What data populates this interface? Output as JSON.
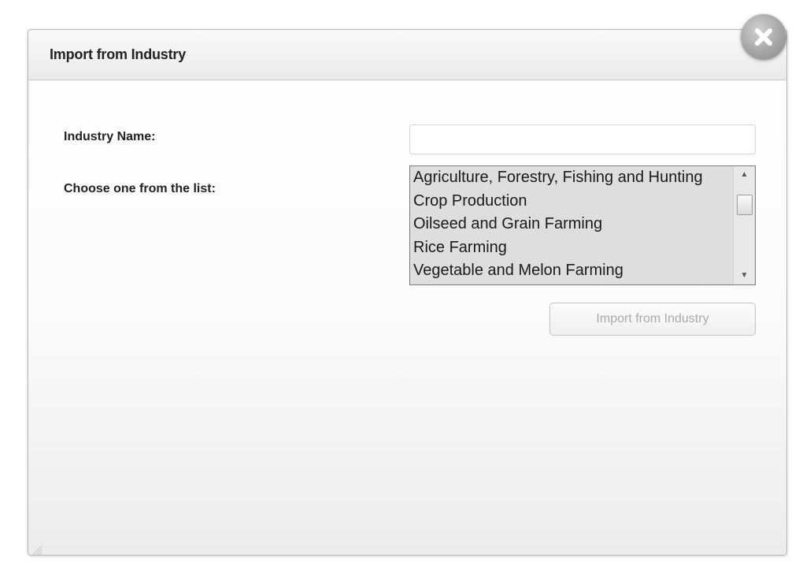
{
  "dialog": {
    "title": "Import from Industry",
    "close_icon": "close-icon"
  },
  "form": {
    "industry_name_label": "Industry Name:",
    "industry_name_value": "",
    "industry_name_placeholder": "",
    "choose_label": "Choose one from the list:",
    "industry_list": [
      "Agriculture, Forestry, Fishing and Hunting",
      "Crop Production",
      "Oilseed and Grain Farming",
      "Rice Farming",
      "Vegetable and Melon Farming"
    ],
    "import_button_label": "Import from Industry",
    "import_button_enabled": false
  },
  "colors": {
    "list_background": "#dedede",
    "disabled_text": "#aaaaaa",
    "label_text": "#222222"
  }
}
